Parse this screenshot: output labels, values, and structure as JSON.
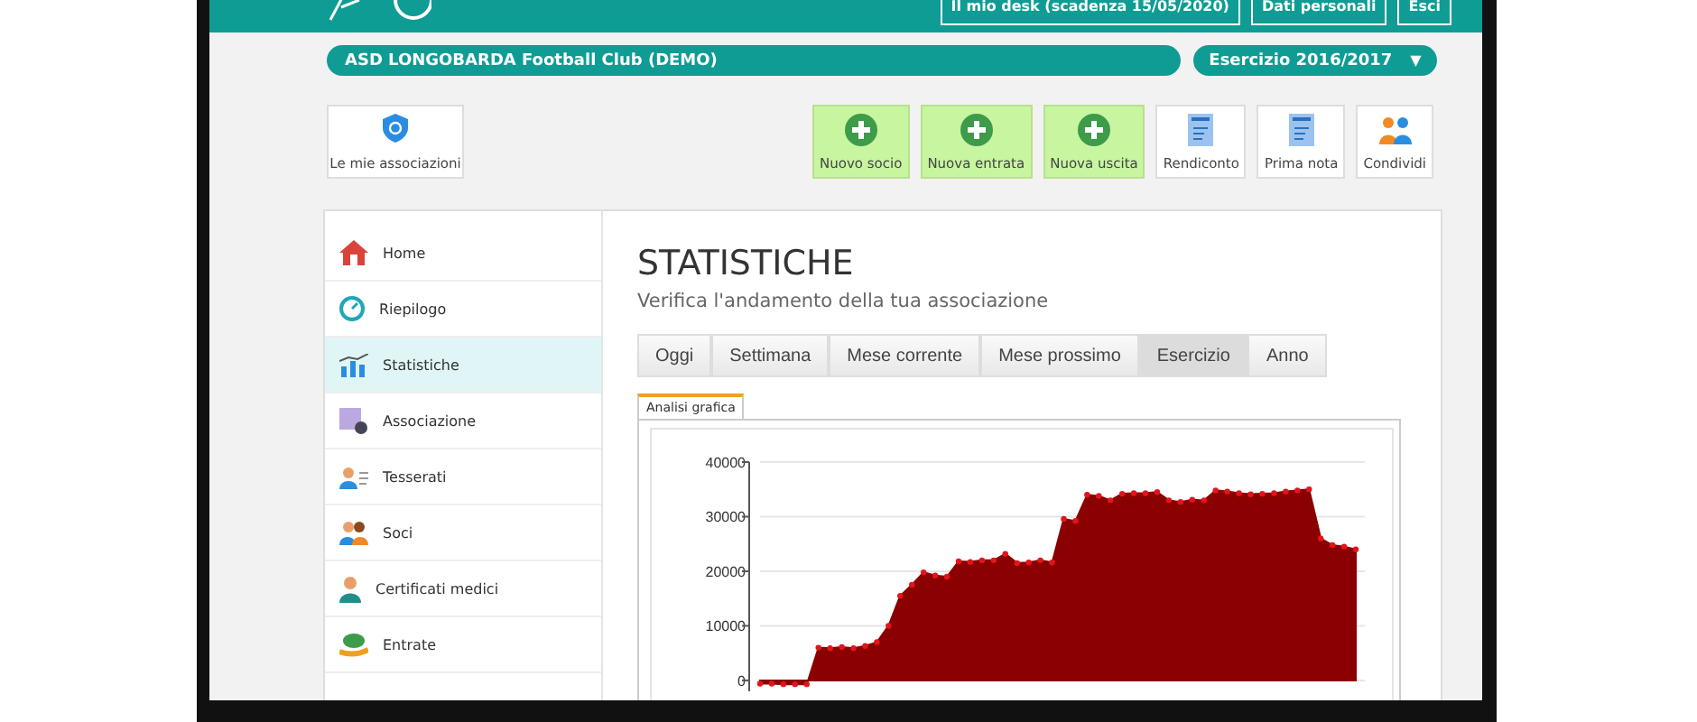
{
  "header": {
    "links": [
      "Il mio desk (scadenza 15/05/2020)",
      "Dati personali",
      "Esci"
    ]
  },
  "club": {
    "name": "ASD LONGOBARDA Football Club (DEMO)",
    "period": "Esercizio 2016/2017",
    "caret": "▼"
  },
  "toolbar": {
    "left": {
      "label": "Le mie associazioni",
      "kind": "shield"
    },
    "actions": [
      {
        "label": "Nuovo socio",
        "kind": "plus"
      },
      {
        "label": "Nuova entrata",
        "kind": "plus"
      },
      {
        "label": "Nuova uscita",
        "kind": "plus"
      },
      {
        "label": "Rendiconto",
        "kind": "doc"
      },
      {
        "label": "Prima nota",
        "kind": "doc"
      },
      {
        "label": "Condividi",
        "kind": "share"
      }
    ]
  },
  "sidebar": {
    "items": [
      {
        "label": "Home",
        "kind": "home",
        "selected": false
      },
      {
        "label": "Riepilogo",
        "kind": "gauge",
        "selected": false
      },
      {
        "label": "Statistiche",
        "kind": "stats",
        "selected": true
      },
      {
        "label": "Associazione",
        "kind": "settings",
        "selected": false
      },
      {
        "label": "Tesserati",
        "kind": "card",
        "selected": false
      },
      {
        "label": "Soci",
        "kind": "people",
        "selected": false
      },
      {
        "label": "Certificati medici",
        "kind": "doctor",
        "selected": false
      },
      {
        "label": "Entrate",
        "kind": "money",
        "selected": false
      }
    ]
  },
  "content": {
    "title": "STATISTICHE",
    "subtitle": "Verifica l'andamento della tua associazione",
    "tabs": [
      {
        "label": "Oggi",
        "selected": false
      },
      {
        "label": "Settimana",
        "selected": false
      },
      {
        "label": "Mese corrente",
        "selected": false
      },
      {
        "label": "Mese prossimo",
        "selected": false
      },
      {
        "label": "Esercizio",
        "selected": true
      },
      {
        "label": "Anno",
        "selected": false
      }
    ],
    "chart_tab": "Analisi grafica",
    "chart_data": {
      "type": "area",
      "ylim": [
        -2000,
        40000
      ],
      "yticks": [
        0,
        10000,
        20000,
        30000,
        40000
      ],
      "grid": true,
      "series": [
        {
          "color": "#8b0000",
          "values": [
            -600,
            -600,
            -700,
            -700,
            -700,
            6000,
            5900,
            6100,
            5900,
            6300,
            7000,
            10000,
            15500,
            17500,
            19800,
            19200,
            19000,
            21800,
            21700,
            22000,
            22000,
            23200,
            21500,
            21600,
            22000,
            21600,
            29600,
            29200,
            34000,
            33800,
            33000,
            34200,
            34300,
            34300,
            34500,
            33000,
            32700,
            33100,
            33000,
            34800,
            34600,
            34300,
            34100,
            34200,
            34300,
            34600,
            34800,
            35000,
            26000,
            24800,
            24500,
            24000
          ]
        }
      ]
    }
  }
}
